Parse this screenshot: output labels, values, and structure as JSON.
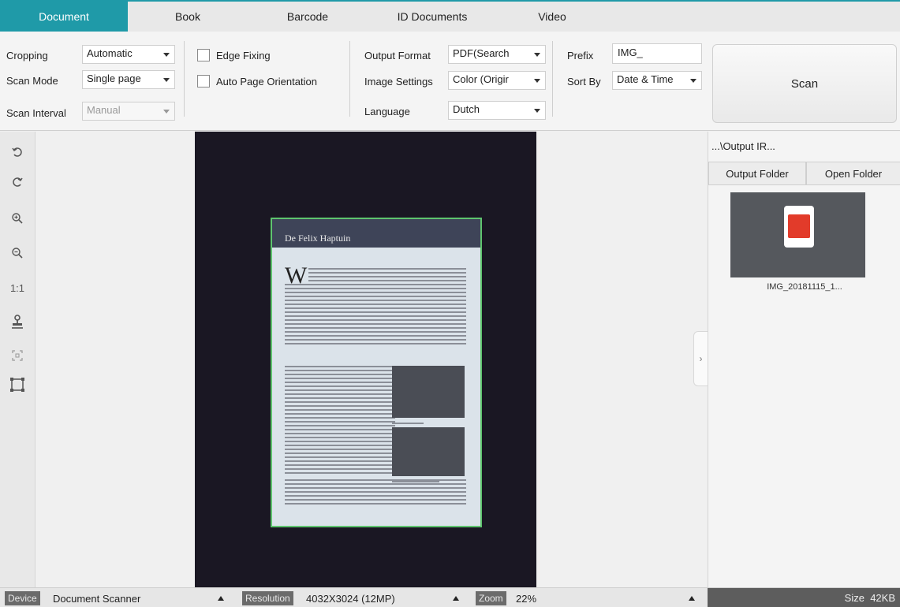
{
  "tabs": [
    "Document",
    "Book",
    "Barcode",
    "ID Documents",
    "Video"
  ],
  "toolbar": {
    "cropping_label": "Cropping",
    "cropping_value": "Automatic",
    "scan_mode_label": "Scan Mode",
    "scan_mode_value": "Single page",
    "scan_interval_label": "Scan Interval",
    "scan_interval_value": "Manual",
    "edge_fixing_label": "Edge Fixing",
    "auto_orientation_label": "Auto Page Orientation",
    "output_format_label": "Output Format",
    "output_format_value": "PDF(Search",
    "image_settings_label": "Image Settings",
    "image_settings_value": "Color (Origir",
    "language_label": "Language",
    "language_value": "Dutch",
    "prefix_label": "Prefix",
    "prefix_value": "IMG_",
    "sort_by_label": "Sort By",
    "sort_by_value": "Date & Time",
    "scan_button": "Scan"
  },
  "left_tools": [
    "rotate-left-icon",
    "rotate-right-icon",
    "zoom-in-icon",
    "zoom-out-icon",
    "actual-size",
    "stamp-icon",
    "fit-icon",
    "crop-frame-icon"
  ],
  "left_tools_text": {
    "actual_size": "1:1"
  },
  "preview": {
    "page_title": "De Felix Haptuin",
    "dropcap": "W"
  },
  "right_panel": {
    "output_path": "...\\Output IR...",
    "output_folder_button": "Output Folder",
    "open_folder_button": "Open Folder",
    "thumbnail_name": "IMG_20181115_1..."
  },
  "status": {
    "device_label": "Device",
    "device_value": "Document Scanner",
    "resolution_label": "Resolution",
    "resolution_value": "4032X3024 (12MP)",
    "zoom_label": "Zoom",
    "zoom_value": "22%",
    "size_label": "Size",
    "size_value": "42KB"
  },
  "colors": {
    "accent": "#1f9aa8",
    "crop_border": "#5ec46e",
    "pdf_red": "#e23b2a"
  }
}
